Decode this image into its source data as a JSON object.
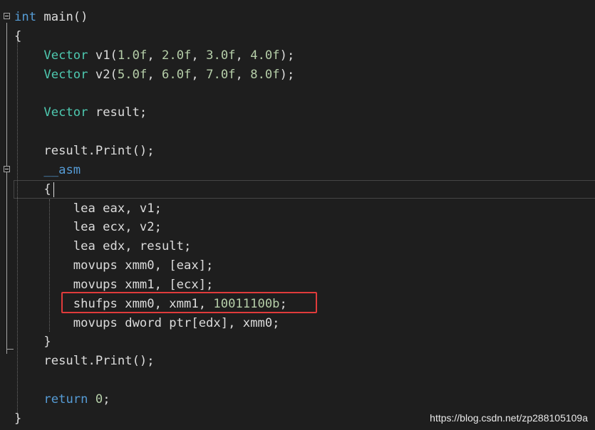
{
  "editor": {
    "lines": [
      "int main()",
      "{",
      "    Vector v1(1.0f, 2.0f, 3.0f, 4.0f);",
      "    Vector v2(5.0f, 6.0f, 7.0f, 8.0f);",
      "",
      "    Vector result;",
      "",
      "    result.Print();",
      "    __asm",
      "    {",
      "        lea eax, v1;",
      "        lea ecx, v2;",
      "        lea edx, result;",
      "        movups xmm0, [eax];",
      "        movups xmm1, [ecx];",
      "        shufps xmm0, xmm1, 10011100b;",
      "        movups dword ptr[edx], xmm0;",
      "    }",
      "    result.Print();",
      "",
      "    return 0;",
      "}"
    ],
    "highlighted_line_index": 15,
    "current_line_index": 9,
    "colors": {
      "background": "#1e1e1e",
      "keyword": "#569cd6",
      "type": "#4ec9b0",
      "number": "#b5cea8",
      "text": "#dcdcdc",
      "highlight_box": "#e03b3b"
    }
  },
  "watermark": "https://blog.csdn.net/zp288105109a"
}
